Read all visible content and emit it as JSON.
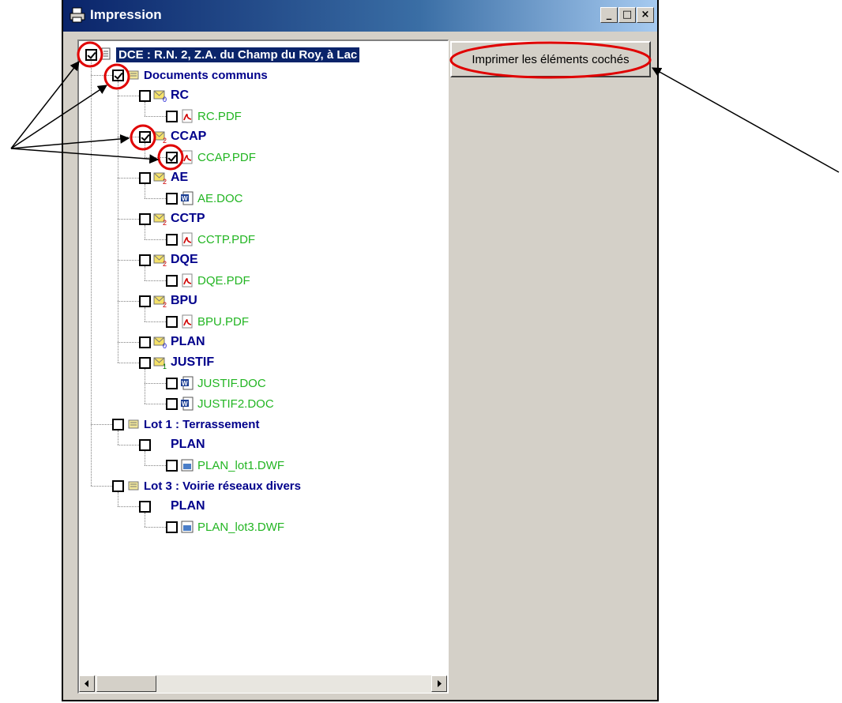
{
  "window": {
    "title": "Impression",
    "controls": [
      "_",
      "□",
      "×"
    ]
  },
  "tree": {
    "root": {
      "label": "DCE : R.N. 2, Z.A. du Champ du Roy, à Lac",
      "checked": true
    },
    "nodes": [
      {
        "label": "Documents communs",
        "type": "lot",
        "checked": true
      },
      {
        "label": "RC",
        "type": "folder",
        "badge": "0",
        "checked": false
      },
      {
        "label": "RC.PDF",
        "type": "pdf",
        "checked": false
      },
      {
        "label": "CCAP",
        "type": "folder",
        "badge": "2",
        "checked": true
      },
      {
        "label": "CCAP.PDF",
        "type": "pdf",
        "checked": true
      },
      {
        "label": "AE",
        "type": "folder",
        "badge": "2",
        "checked": false
      },
      {
        "label": "AE.DOC",
        "type": "doc",
        "checked": false
      },
      {
        "label": "CCTP",
        "type": "folder",
        "badge": "2",
        "checked": false
      },
      {
        "label": "CCTP.PDF",
        "type": "pdf",
        "checked": false
      },
      {
        "label": "DQE",
        "type": "folder",
        "badge": "2",
        "checked": false
      },
      {
        "label": "DQE.PDF",
        "type": "pdf",
        "checked": false
      },
      {
        "label": "BPU",
        "type": "folder",
        "badge": "2",
        "checked": false
      },
      {
        "label": "BPU.PDF",
        "type": "pdf",
        "checked": false
      },
      {
        "label": "PLAN",
        "type": "folder",
        "badge": "0",
        "checked": false
      },
      {
        "label": "JUSTIF",
        "type": "folder",
        "badge": "1",
        "checked": false
      },
      {
        "label": "JUSTIF.DOC",
        "type": "doc",
        "checked": false
      },
      {
        "label": "JUSTIF2.DOC",
        "type": "doc",
        "checked": false
      },
      {
        "label": "Lot 1 : Terrassement",
        "type": "lot",
        "checked": false
      },
      {
        "label": "PLAN",
        "type": "plain-folder",
        "checked": false
      },
      {
        "label": "PLAN_lot1.DWF",
        "type": "dwf",
        "checked": false
      },
      {
        "label": "Lot 3 : Voirie réseaux divers",
        "type": "lot",
        "checked": false
      },
      {
        "label": "PLAN",
        "type": "plain-folder",
        "checked": false
      },
      {
        "label": "PLAN_lot3.DWF",
        "type": "dwf",
        "checked": false
      }
    ]
  },
  "actions": {
    "print_label": "Imprimer les éléments cochés"
  },
  "colors": {
    "title_bar": "#0a246a",
    "folder_text": "#00008b",
    "file_text": "#22b522",
    "annotation": "#e00000"
  }
}
